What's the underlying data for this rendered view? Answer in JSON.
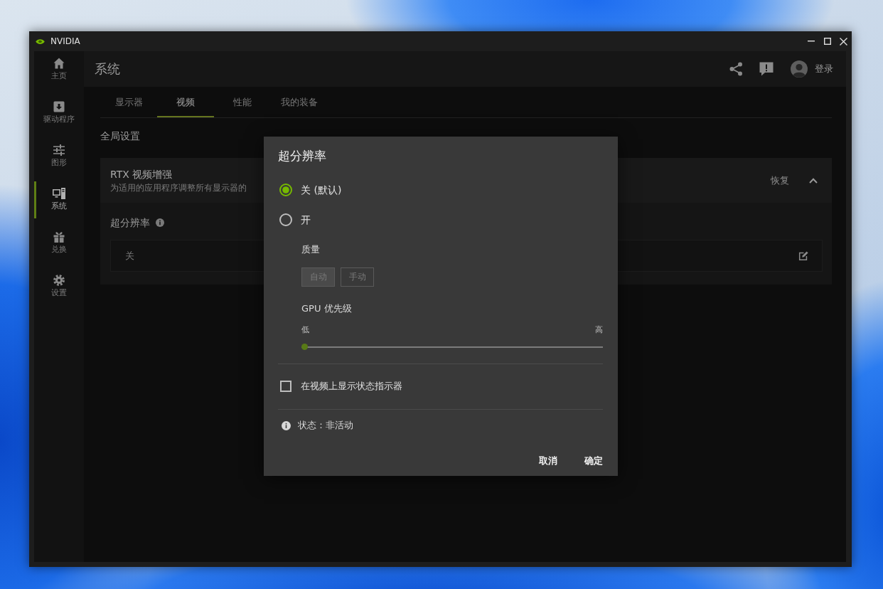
{
  "window": {
    "title": "NVIDIA"
  },
  "sidebar": {
    "items": [
      {
        "label": "主页",
        "selected": false
      },
      {
        "label": "驱动程序",
        "selected": false
      },
      {
        "label": "图形",
        "selected": false
      },
      {
        "label": "系统",
        "selected": true
      },
      {
        "label": "兑换",
        "selected": false
      },
      {
        "label": "设置",
        "selected": false
      }
    ]
  },
  "header": {
    "title": "系统",
    "login": "登录"
  },
  "tabs": [
    {
      "label": "显示器",
      "selected": false
    },
    {
      "label": "视频",
      "selected": true
    },
    {
      "label": "性能",
      "selected": false
    },
    {
      "label": "我的装备",
      "selected": false
    }
  ],
  "section_title": "全局设置",
  "panel": {
    "title": "RTX 视频增强",
    "subtitle": "为适用的应用程序调整所有显示器的",
    "restore": "恢复",
    "expanded": true,
    "setting": {
      "label": "超分辨率",
      "value": "关"
    }
  },
  "dialog": {
    "title": "超分辨率",
    "options": [
      {
        "label": "关 (默认)",
        "selected": true
      },
      {
        "label": "开",
        "selected": false
      }
    ],
    "quality": {
      "label": "质量",
      "buttons": [
        {
          "label": "自动",
          "selected": true,
          "disabled": true
        },
        {
          "label": "手动",
          "selected": false,
          "disabled": true
        }
      ]
    },
    "gpu_priority": {
      "label": "GPU 优先级",
      "low": "低",
      "high": "高",
      "level": 0,
      "disabled": true
    },
    "indicator": {
      "label": "在视频上显示状态指示器",
      "checked": false
    },
    "status": "状态：非活动",
    "buttons": [
      "取消",
      "确定"
    ]
  }
}
